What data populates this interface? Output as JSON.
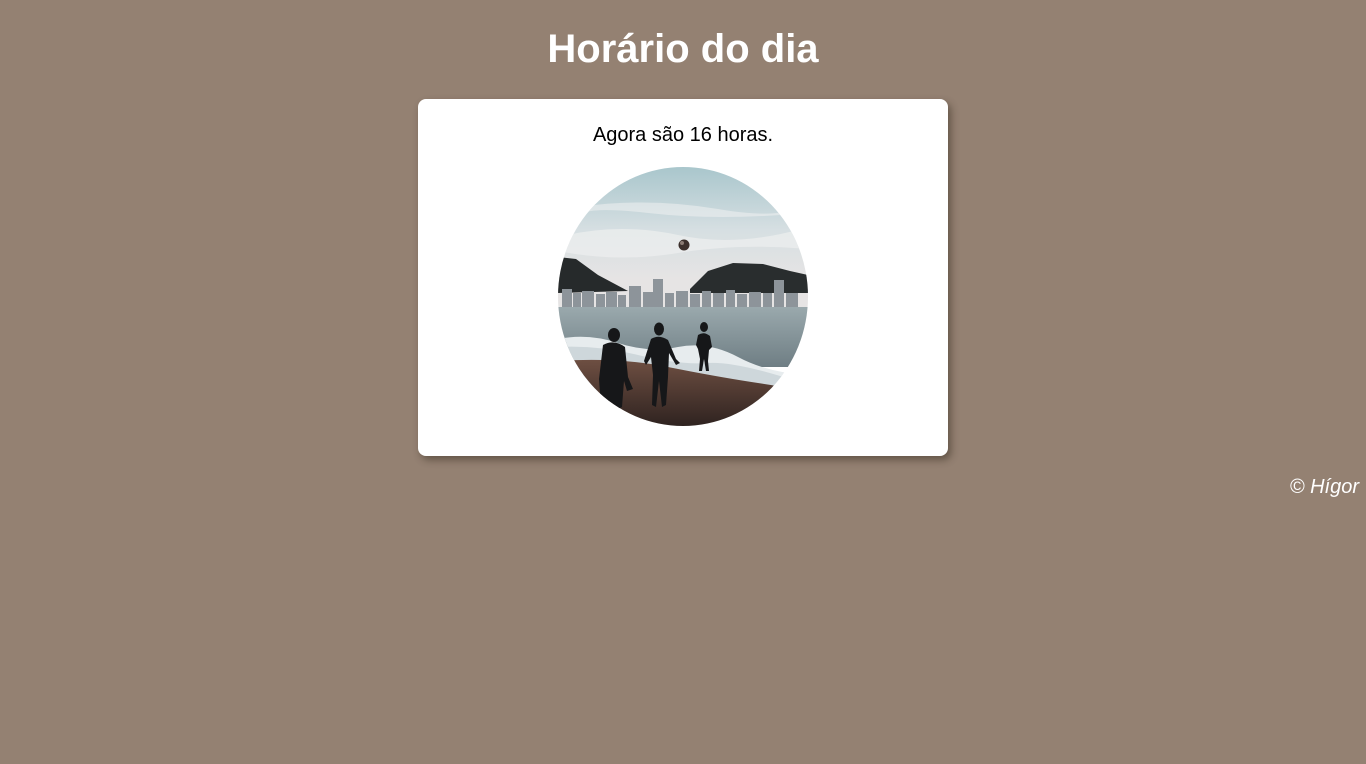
{
  "header": {
    "title": "Horário do dia"
  },
  "card": {
    "message": "Agora são 16 horas."
  },
  "footer": {
    "copyright": "© Hígor"
  },
  "colors": {
    "page_background": "#948172",
    "card_background": "#ffffff",
    "title_color": "#ffffff"
  }
}
